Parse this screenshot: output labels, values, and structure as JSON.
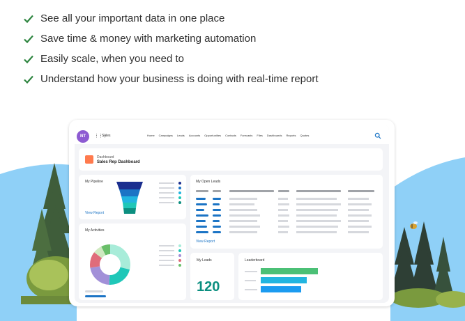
{
  "features": [
    {
      "text": "See all your important data in one place",
      "icon": "checkmark-icon"
    },
    {
      "text": "Save time & money with marketing automation",
      "icon": "checkmark-icon"
    },
    {
      "text": "Easily scale, when you need to",
      "icon": "checkmark-icon"
    },
    {
      "text": "Understand how your business is doing with real-time report",
      "icon": "checkmark-icon"
    }
  ],
  "colors": {
    "check": "#2e8540",
    "sky": "#8fd0f7",
    "accent_blue": "#1b74c5",
    "teal": "#0c8f80"
  },
  "dashboard": {
    "avatar": "NT",
    "app_name": "Sales",
    "nav": [
      "Home",
      "Campaigns",
      "Leads",
      "Accounts",
      "Opportunities",
      "Contacts",
      "Forecasts",
      "Files",
      "Dashboards",
      "Reports",
      "Quotes"
    ],
    "header_sup": "Dashboard",
    "header_title": "Sales Rep Dashboard",
    "pipeline_title": "My Pipeline",
    "view_report": "View Report",
    "open_leads_title": "My Open Leads",
    "activities_title": "My Activities",
    "leads_title": "My Leads",
    "leads_count": "120",
    "leaderboard_title": "Leaderboard"
  }
}
